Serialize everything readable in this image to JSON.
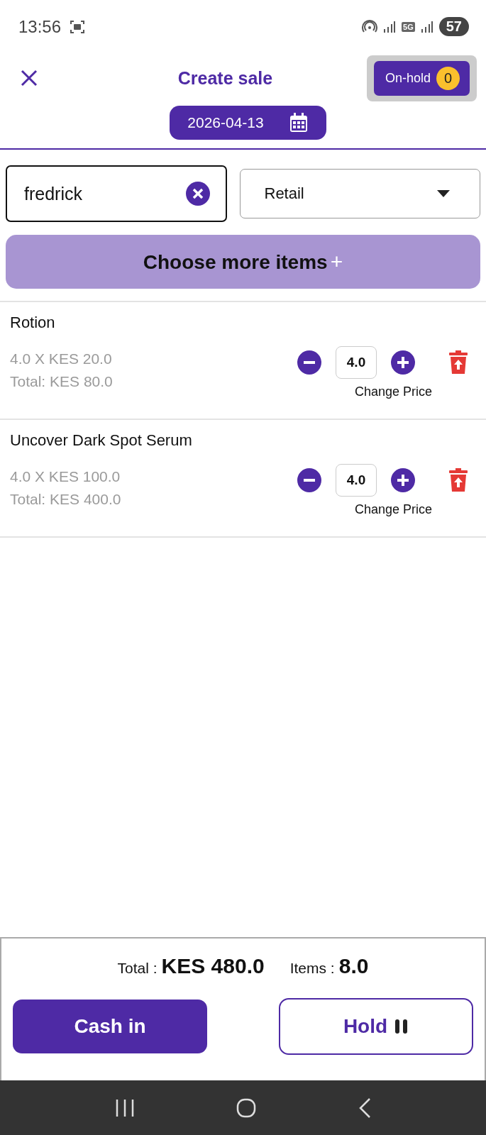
{
  "status_bar": {
    "time": "13:56",
    "network": "5G",
    "battery": "57"
  },
  "header": {
    "title": "Create sale",
    "on_hold": {
      "label": "On-hold",
      "count": "0"
    },
    "date": "2026-04-13"
  },
  "customer": {
    "value": "fredrick"
  },
  "price_type": {
    "value": "Retail"
  },
  "choose_button": {
    "label": "Choose more items",
    "icon": "+"
  },
  "items": [
    {
      "name": "Rotion",
      "line": "4.0 X KES 20.0",
      "total": "Total: KES 80.0",
      "quantity": "4.0",
      "change_price": "Change Price"
    },
    {
      "name": "Uncover Dark Spot Serum",
      "line": "4.0 X KES 100.0",
      "total": "Total: KES 400.0",
      "quantity": "4.0",
      "change_price": "Change Price"
    }
  ],
  "summary": {
    "total_label": "Total :",
    "total_value": "KES 480.0",
    "items_label": "Items :",
    "items_value": "8.0"
  },
  "buttons": {
    "cash_in": "Cash in",
    "hold": "Hold"
  }
}
